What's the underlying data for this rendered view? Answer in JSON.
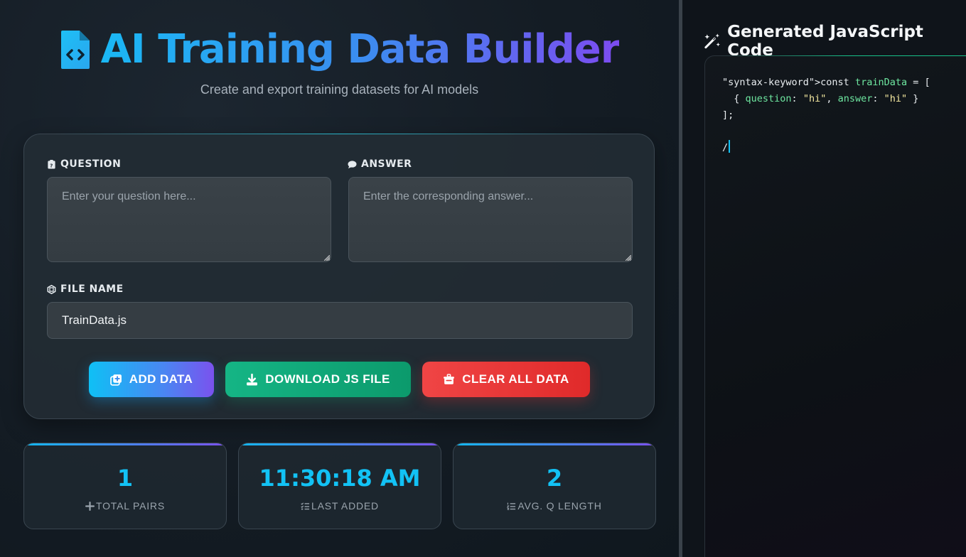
{
  "header": {
    "title": "AI Training Data Builder",
    "subtitle": "Create and export training datasets for AI models"
  },
  "form": {
    "question_label": "QUESTION",
    "question_placeholder": "Enter your question here...",
    "answer_label": "ANSWER",
    "answer_placeholder": "Enter the corresponding answer...",
    "filename_label": "FILE NAME",
    "filename_value": "TrainData.js"
  },
  "buttons": {
    "add": "ADD DATA",
    "download": "DOWNLOAD JS FILE",
    "clear": "CLEAR ALL DATA"
  },
  "stats": [
    {
      "value": "1",
      "label": "TOTAL PAIRS",
      "icon": "plus-icon"
    },
    {
      "value": "11:30:18 AM",
      "label": "LAST ADDED",
      "icon": "list-check-icon"
    },
    {
      "value": "2",
      "label": "AVG. Q LENGTH",
      "icon": "list-ol-icon"
    }
  ],
  "code_panel": {
    "title": "Generated JavaScript Code",
    "line1_prefix": "\"syntax-keyword\">const ",
    "line1_var": "trainData",
    "line1_suffix": " = [",
    "entry_open": "  { ",
    "entry_key1": "question",
    "entry_colon1": ": ",
    "entry_val1": "\"hi\"",
    "entry_sep": ", ",
    "entry_key2": "answer",
    "entry_colon2": ": ",
    "entry_val2": "\"hi\"",
    "entry_close": " }",
    "line3": "];",
    "line5": "/"
  },
  "colors": {
    "accent": "#12c2f5",
    "purple": "#7a52ee",
    "green": "#15b585",
    "red": "#f04545"
  }
}
